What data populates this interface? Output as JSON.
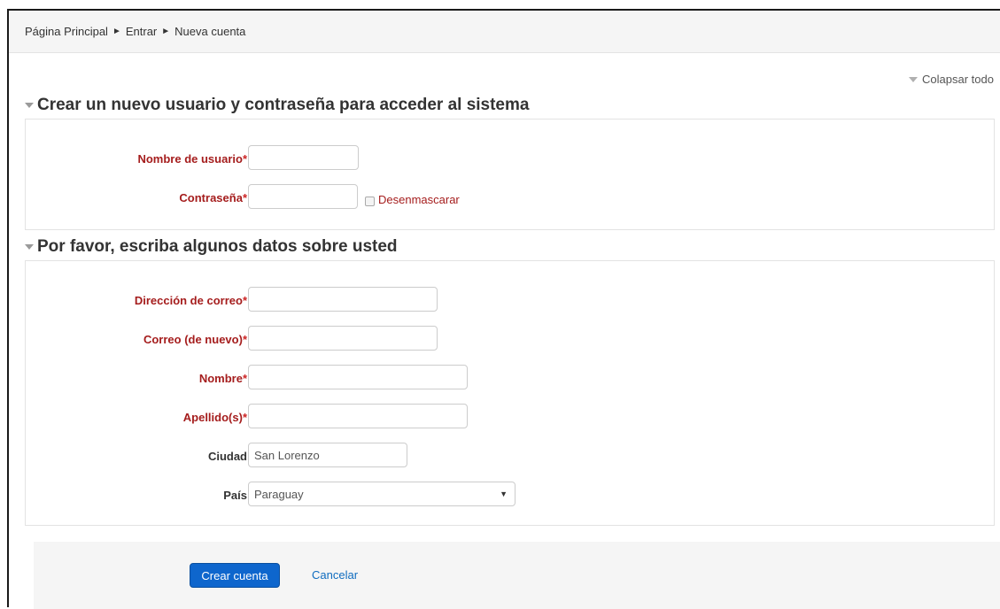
{
  "breadcrumb": {
    "items": [
      "Página Principal",
      "Entrar",
      "Nueva cuenta"
    ],
    "separator": "►"
  },
  "collapse_all": "Colapsar todo",
  "section1": {
    "title": "Crear un nuevo usuario y contraseña para acceder al sistema",
    "username_label": "Nombre de usuario",
    "username_value": "",
    "password_label": "Contraseña",
    "password_value": "",
    "unmask_label": "Desenmascarar",
    "unmask_checked": false
  },
  "section2": {
    "title": "Por favor, escriba algunos datos sobre usted",
    "email_label": "Dirección de correo",
    "email_value": "",
    "email_again_label": "Correo (de nuevo)",
    "email_again_value": "",
    "firstname_label": "Nombre",
    "firstname_value": "",
    "lastname_label": "Apellido(s)",
    "lastname_value": "",
    "city_label": "Ciudad",
    "city_value": "San Lorenzo",
    "country_label": "País",
    "country_value": "Paraguay"
  },
  "required_marker": "*",
  "buttons": {
    "create": "Crear cuenta",
    "cancel": "Cancelar"
  },
  "colors": {
    "required_label": "#a51d1d",
    "primary_button": "#0e66cd",
    "link": "#0f6cbf"
  }
}
